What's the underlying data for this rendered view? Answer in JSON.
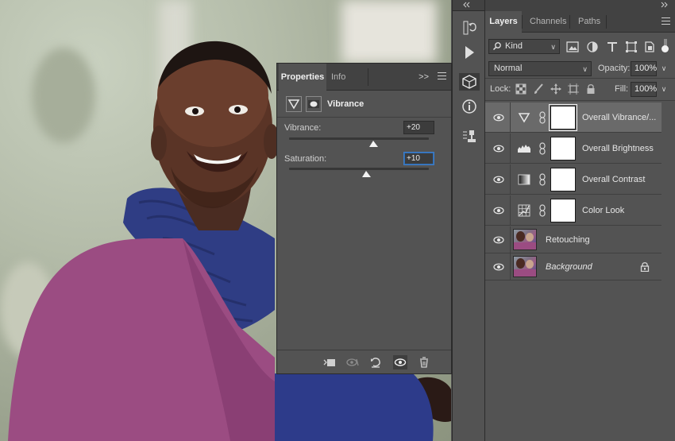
{
  "properties": {
    "tabs": [
      {
        "label": "Properties"
      },
      {
        "label": "Info"
      }
    ],
    "collapse_label": ">>",
    "adjustment_title": "Vibrance",
    "sliders": [
      {
        "label": "Vibrance:",
        "value": "+20",
        "position": 0.6
      },
      {
        "label": "Saturation:",
        "value": "+10",
        "position": 0.55
      }
    ],
    "footer_icons": [
      "clip-to-layer-icon",
      "view-previous-state-icon",
      "reset-icon",
      "visibility-icon",
      "trash-icon"
    ]
  },
  "tool_strip": {
    "icons": [
      "history-icon",
      "actions-play-icon",
      "3d-cube-icon",
      "info-icon",
      "properties-icon"
    ]
  },
  "layers": {
    "tabs": [
      {
        "label": "Layers"
      },
      {
        "label": "Channels"
      },
      {
        "label": "Paths"
      }
    ],
    "filter": {
      "value": "Kind"
    },
    "blend_mode": "Normal",
    "opacity_label": "Opacity:",
    "opacity_value": "100%",
    "lock_label": "Lock:",
    "fill_label": "Fill:",
    "fill_value": "100%",
    "items": [
      {
        "name": "Overall Vibrance/...",
        "type": "vibrance-adjustment-icon",
        "selected": true,
        "italic": false
      },
      {
        "name": "Overall Brightness",
        "type": "levels-adjustment-icon",
        "selected": false,
        "italic": false
      },
      {
        "name": "Overall Contrast",
        "type": "gradient-map-adjustment-icon",
        "selected": false,
        "italic": false
      },
      {
        "name": "Color Look",
        "type": "color-lookup-adjustment-icon",
        "selected": false,
        "italic": false
      },
      {
        "name": "Retouching",
        "type": "photo-thumbnail",
        "selected": false,
        "italic": false
      },
      {
        "name": "Background",
        "type": "photo-thumbnail",
        "selected": false,
        "italic": true,
        "locked": true
      }
    ]
  }
}
